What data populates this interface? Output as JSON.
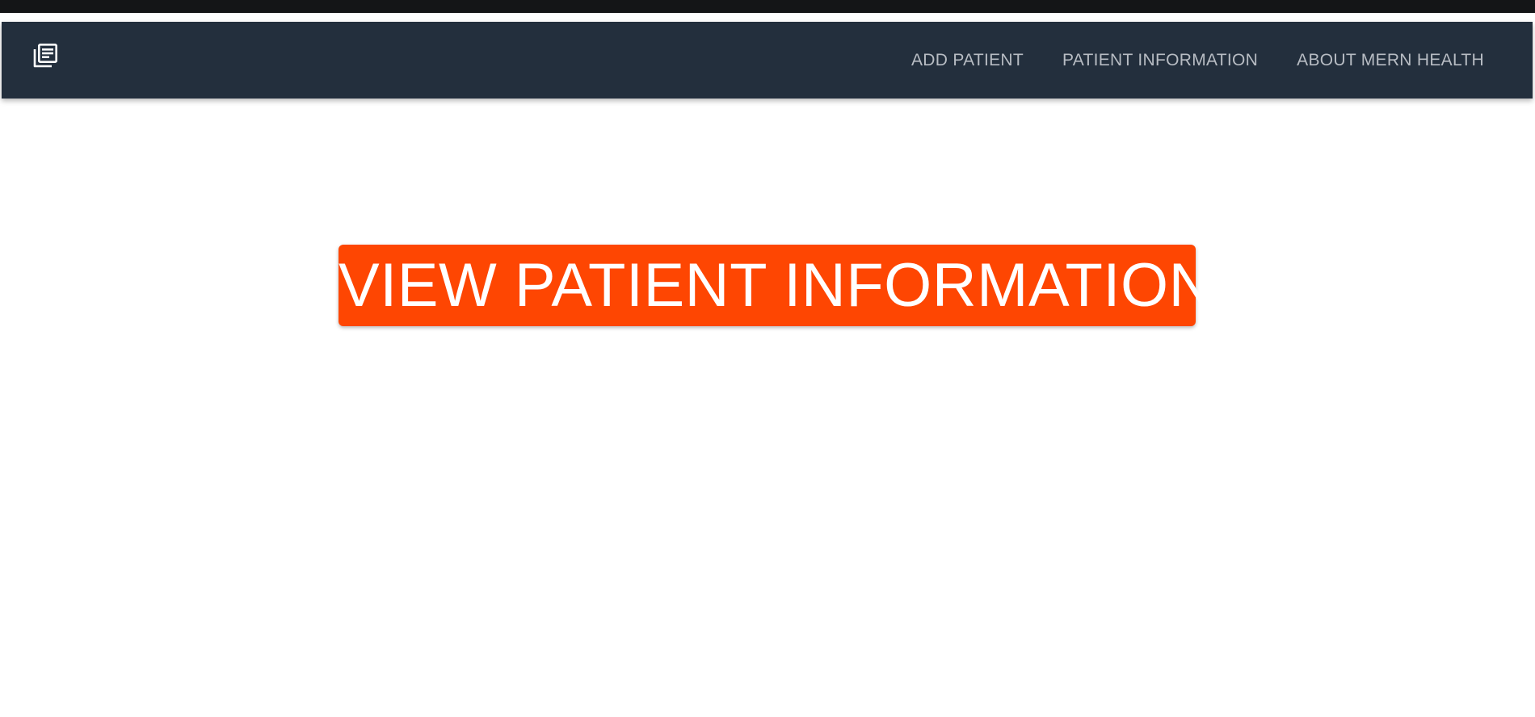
{
  "colors": {
    "navbar_bg": "#232f3d",
    "nav_link": "#b7bcc3",
    "accent": "#fe4602",
    "button_text": "#ffffff",
    "page_bg": "#ffffff"
  },
  "navbar": {
    "logo_icon": "library-books-icon",
    "links": [
      {
        "label": "ADD PATIENT"
      },
      {
        "label": "PATIENT INFORMATION"
      },
      {
        "label": "ABOUT MERN HEALTH"
      }
    ]
  },
  "main": {
    "cta_label": "VIEW PATIENT INFORMATION"
  }
}
